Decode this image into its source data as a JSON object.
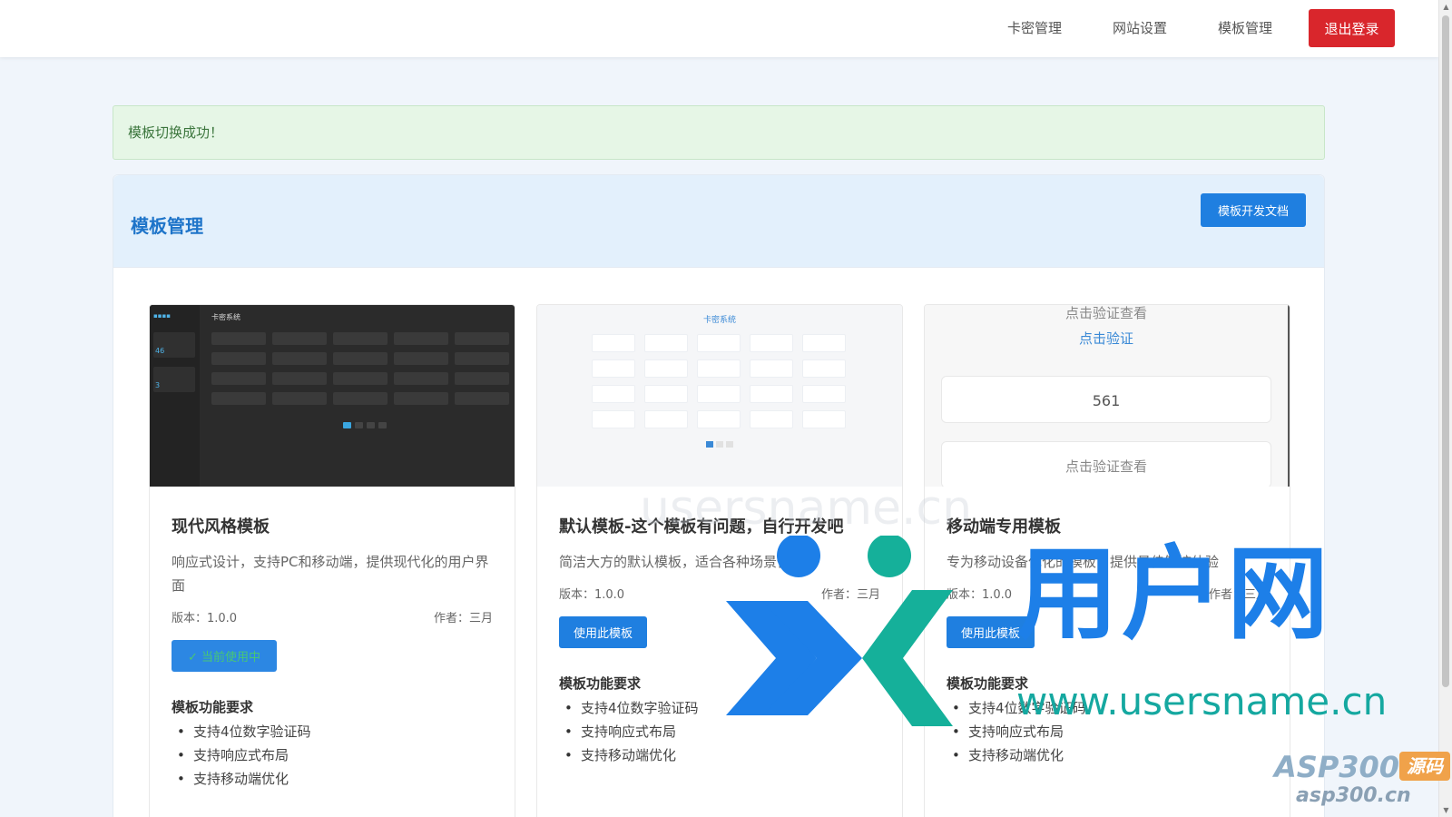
{
  "nav": {
    "links": [
      "卡密管理",
      "网站设置",
      "模板管理"
    ],
    "logout": "退出登录"
  },
  "alert": {
    "message": "模板切换成功！"
  },
  "panel": {
    "title": "模板管理",
    "doc_button": "模板开发文档"
  },
  "templates": [
    {
      "title": "现代风格模板",
      "desc": "响应式设计，支持PC和移动端，提供现代化的用户界面",
      "version": "版本：1.0.0",
      "author": "作者：三月",
      "button": "✓ 当前使用中",
      "current": true,
      "req_title": "模板功能要求",
      "reqs": [
        "支持4位数字验证码",
        "支持响应式布局",
        "支持移动端优化"
      ]
    },
    {
      "title": "默认模板-这个模板有问题，自行开发吧",
      "desc": "简洁大方的默认模板，适合各种场景使用",
      "version": "版本：1.0.0",
      "author": "作者：三月",
      "button": "使用此模板",
      "current": false,
      "req_title": "模板功能要求",
      "reqs": [
        "支持4位数字验证码",
        "支持响应式布局",
        "支持移动端优化"
      ]
    },
    {
      "title": "移动端专用模板",
      "desc": "专为移动设备优化的模板，提供最佳触控体验",
      "version": "版本：1.0.0",
      "author": "作者：三月",
      "button": "使用此模板",
      "current": false,
      "req_title": "模板功能要求",
      "reqs": [
        "支持4位数字验证码",
        "支持响应式布局",
        "支持移动端优化"
      ]
    }
  ],
  "thumbs": {
    "t1_head": "卡密系统",
    "t1_side_num1": "46",
    "t1_side_num2": "3",
    "t2_head": "卡密系统",
    "t3_line1": "点击验证查看",
    "t3_line2": "点击验证",
    "t3_code": "561",
    "t3_line3": "点击验证查看"
  },
  "watermark": {
    "brand": "用户网",
    "url": "www.usersname.cn",
    "faint": "usersname.cn",
    "asp": "ASP300",
    "asp_badge": "源码",
    "asp_url": "asp300.cn"
  },
  "colors": {
    "primary": "#1f7fe0",
    "danger": "#d9262c",
    "success_bg": "#e6f6e6",
    "header_bg": "#e3f0fc"
  }
}
